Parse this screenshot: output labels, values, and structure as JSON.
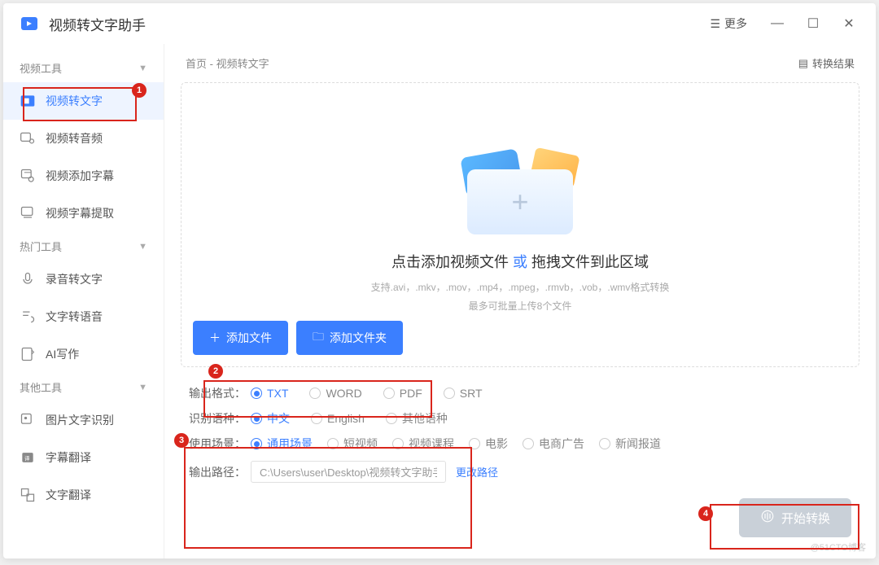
{
  "app": {
    "title": "视频转文字助手"
  },
  "titlebar": {
    "more": "更多"
  },
  "breadcrumb": {
    "home": "首页",
    "sep": "-",
    "page": "视频转文字"
  },
  "result_link": "转换结果",
  "sidebar": {
    "sections": [
      {
        "title": "视频工具",
        "items": [
          {
            "icon": "video-to-text-icon",
            "label": "视频转文字",
            "active": true
          },
          {
            "icon": "video-to-audio-icon",
            "label": "视频转音频"
          },
          {
            "icon": "add-subtitle-icon",
            "label": "视频添加字幕"
          },
          {
            "icon": "extract-subtitle-icon",
            "label": "视频字幕提取"
          }
        ]
      },
      {
        "title": "热门工具",
        "items": [
          {
            "icon": "audio-to-text-icon",
            "label": "录音转文字"
          },
          {
            "icon": "text-to-speech-icon",
            "label": "文字转语音"
          },
          {
            "icon": "ai-writing-icon",
            "label": "AI写作"
          }
        ]
      },
      {
        "title": "其他工具",
        "items": [
          {
            "icon": "ocr-icon",
            "label": "图片文字识别"
          },
          {
            "icon": "subtitle-translate-icon",
            "label": "字幕翻译"
          },
          {
            "icon": "text-translate-icon",
            "label": "文字翻译"
          }
        ]
      }
    ]
  },
  "dropzone": {
    "title_left": "点击添加视频文件",
    "title_or": "或",
    "title_right": "拖拽文件到此区域",
    "formats": "支持.avi，.mkv，.mov，.mp4，.mpeg，.rmvb，.vob，.wmv格式转换",
    "max": "最多可批量上传8个文件",
    "add_file": "添加文件",
    "add_folder": "添加文件夹"
  },
  "options": {
    "format_label": "输出格式：",
    "formats": [
      "TXT",
      "WORD",
      "PDF",
      "SRT"
    ],
    "format_sel": 0,
    "lang_label": "识别语种：",
    "langs": [
      "中文",
      "English",
      "其他语种"
    ],
    "lang_sel": 0,
    "scene_label": "使用场景：",
    "scenes": [
      "通用场景",
      "短视频",
      "视频课程",
      "电影",
      "电商广告",
      "新闻报道"
    ],
    "scene_sel": 0,
    "path_label": "输出路径：",
    "path": "C:\\Users\\user\\Desktop\\视频转文字助手",
    "change": "更改路径"
  },
  "start_btn": "开始转换",
  "watermark": "@51CTO博客",
  "annotations": {
    "a1": "1",
    "a2": "2",
    "a3": "3",
    "a4": "4"
  }
}
